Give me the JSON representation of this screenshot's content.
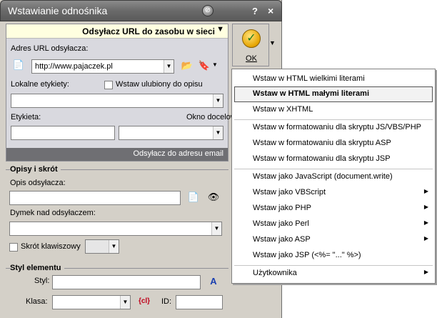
{
  "window": {
    "title": "Wstawianie odnośnika",
    "help": "?",
    "close": "×",
    "pin_glyph": "⊘"
  },
  "link_panel": {
    "header": "Odsyłacz URL do zasobu w sieci",
    "url_label": "Adres URL odsyłacza:",
    "url_value": "http://www.pajaczek.pl",
    "local_tags_label": "Lokalne etykiety:",
    "fav_checkbox_label": "Wstaw ulubiony do opisu",
    "tag_label": "Etykieta:",
    "target_label": "Okno docelowe:",
    "email_button": "Odsyłacz do adresu email"
  },
  "desc_section": {
    "heading": "Opisy i skrót",
    "desc_label": "Opis odsyłacza:",
    "tooltip_label": "Dymek nad odsyłaczem:",
    "shortcut_label": "Skrót klawiszowy"
  },
  "style_section": {
    "heading": "Styl elementu",
    "style_label": "Styl:",
    "class_label": "Klasa:",
    "id_label": "ID:"
  },
  "ok_button": {
    "label": "OK"
  },
  "menu": {
    "items": [
      {
        "label": "Wstaw w HTML wielkimi literami"
      },
      {
        "label": "Wstaw w HTML małymi literami"
      },
      {
        "label": "Wstaw w XHTML"
      },
      {
        "label": "Wstaw w formatowaniu dla skryptu JS/VBS/PHP"
      },
      {
        "label": "Wstaw w formatowaniu dla skryptu ASP"
      },
      {
        "label": "Wstaw w formatowaniu dla skryptu JSP"
      },
      {
        "label": "Wstaw jako JavaScript (document.write)"
      },
      {
        "label": "Wstaw jako VBScript"
      },
      {
        "label": "Wstaw jako PHP"
      },
      {
        "label": "Wstaw jako Perl"
      },
      {
        "label": "Wstaw jako ASP"
      },
      {
        "label": "Wstaw jako JSP (<%= \"...\" %>)"
      },
      {
        "label": "Użytkownika"
      }
    ],
    "selected": "Wstaw w HTML małymi literami"
  }
}
